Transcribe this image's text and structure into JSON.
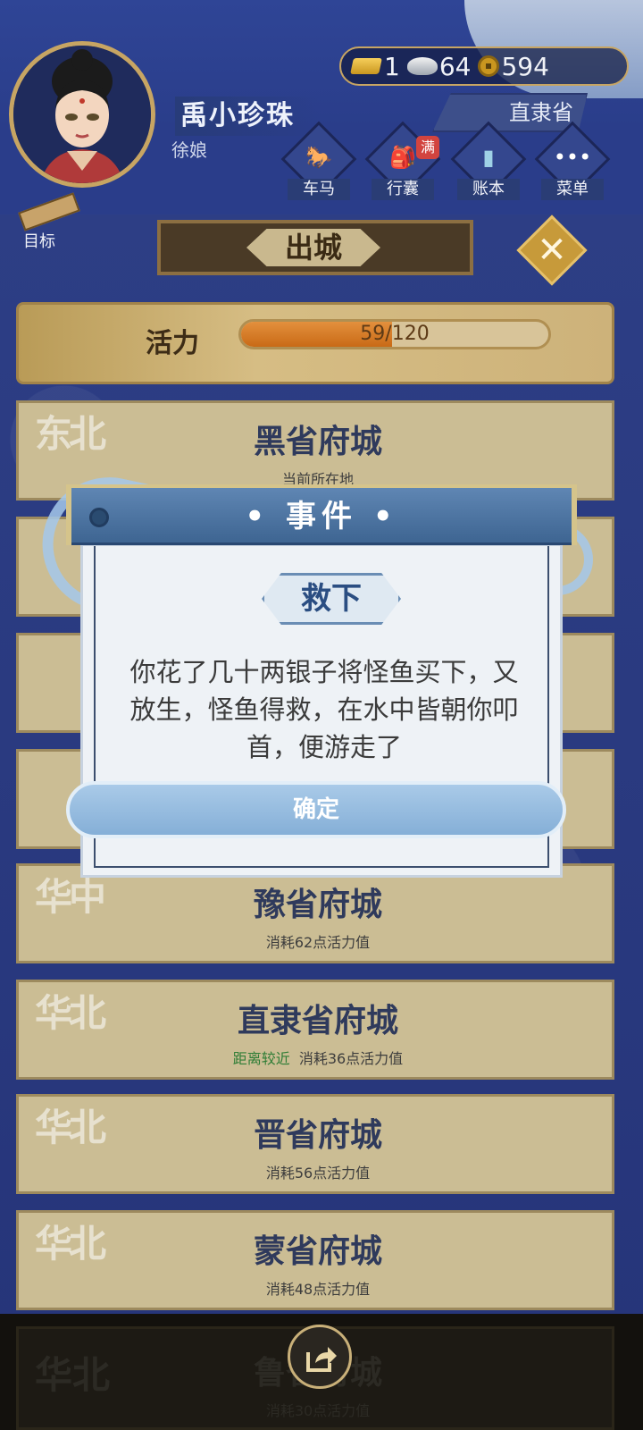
{
  "player": {
    "name": "禹小珍珠",
    "title": "徐娘"
  },
  "currency": {
    "gold": "1",
    "silver": "64",
    "coins": "594"
  },
  "location": "直隶省",
  "menu": [
    {
      "label": "车马",
      "icon": "carriage-icon"
    },
    {
      "label": "行囊",
      "icon": "bag-icon",
      "badge": "满"
    },
    {
      "label": "账本",
      "icon": "ledger-icon"
    },
    {
      "label": "菜单",
      "icon": "more-icon"
    }
  ],
  "goal_label": "目标",
  "page_title": "出城",
  "stamina": {
    "label": "活力",
    "value": "59/120",
    "current": 59,
    "max": 120
  },
  "cities": [
    {
      "region": "东北",
      "name": "黑省府城",
      "info": "当前所在地",
      "near": ""
    },
    {
      "region": "华中",
      "name": "豫省府城",
      "info": "消耗62点活力值",
      "near": ""
    },
    {
      "region": "华北",
      "name": "直隶省府城",
      "info": "消耗36点活力值",
      "near": "距离较近"
    },
    {
      "region": "华北",
      "name": "晋省府城",
      "info": "消耗56点活力值",
      "near": ""
    },
    {
      "region": "华北",
      "name": "蒙省府城",
      "info": "消耗48点活力值",
      "near": ""
    }
  ],
  "bottom_city": {
    "region": "华北",
    "name": "鲁省府城",
    "info": "消耗30点活力值"
  },
  "modal": {
    "title": "• 事件 •",
    "subtitle": "救下",
    "message": "你花了几十两银子将怪鱼买下，又放生，怪鱼得救，在水中皆朝你叩首，便游走了",
    "confirm": "确定"
  },
  "colors": {
    "bg": "#2b3a7a",
    "modal_header": "#4f77a5",
    "confirm": "#9cc0e2",
    "gold": "#c7a563"
  }
}
